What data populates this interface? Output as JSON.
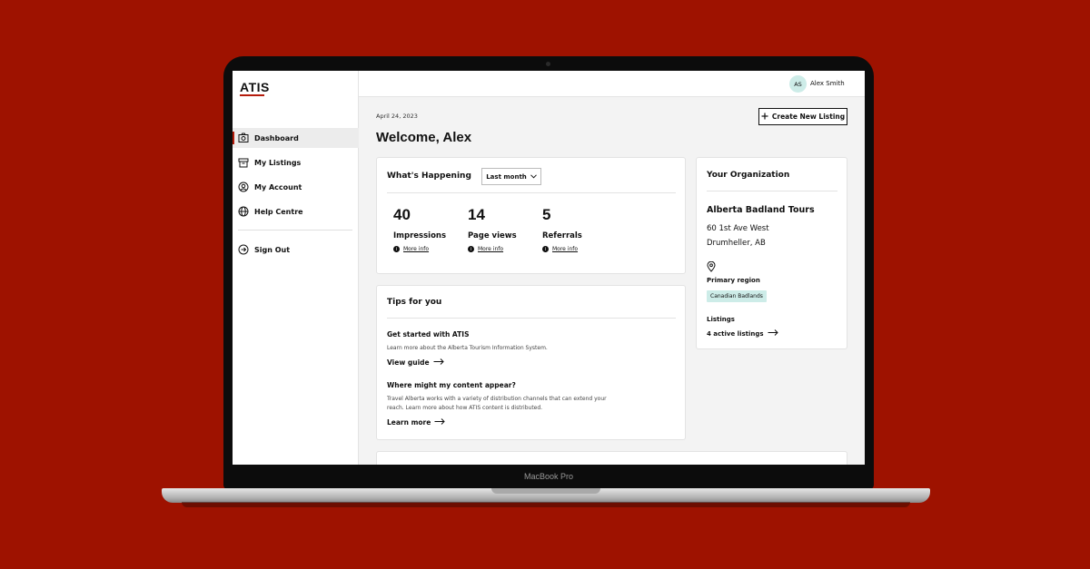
{
  "device": {
    "label": "MacBook Pro"
  },
  "sidebar": {
    "logo": "ATIS",
    "items": [
      {
        "label": "Dashboard",
        "icon": "dashboard-icon",
        "active": true
      },
      {
        "label": "My Listings",
        "icon": "listings-icon"
      },
      {
        "label": "My Account",
        "icon": "account-icon"
      },
      {
        "label": "Help Centre",
        "icon": "globe-icon"
      }
    ],
    "sign_out": {
      "label": "Sign Out",
      "icon": "sign-out-icon"
    }
  },
  "header": {
    "user_initials": "AS",
    "user_name": "Alex Smith"
  },
  "main": {
    "date": "April 24, 2023",
    "create_button": "Create New Listing",
    "welcome": "Welcome, Alex",
    "happening": {
      "title": "What's Happening",
      "period": "Last month",
      "stats": [
        {
          "value": "40",
          "label": "Impressions",
          "info": "More info"
        },
        {
          "value": "14",
          "label": "Page views",
          "info": "More info"
        },
        {
          "value": "5",
          "label": "Referrals",
          "info": "More info"
        }
      ]
    },
    "tips": {
      "title": "Tips for you",
      "items": [
        {
          "heading": "Get started with ATIS",
          "body": "Learn more about the Alberta Tourism Information System.",
          "link": "View guide"
        },
        {
          "heading": "Where might my content appear?",
          "body": "Travel Alberta works with a variety of distribution channels that can extend your reach. Learn more about how ATIS content is distributed.",
          "link": "Learn more"
        }
      ]
    },
    "organization": {
      "title": "Your Organization",
      "name": "Alberta Badland Tours",
      "address_line1": "60 1st Ave West",
      "address_line2": "Drumheller, AB",
      "region_label": "Primary region",
      "region": "Canadian Badlands",
      "listings_label": "Listings",
      "listings_link": "4 active listings"
    }
  },
  "colors": {
    "background": "#9e1200",
    "accent": "#b51c0c",
    "badge": "#cdece8"
  }
}
